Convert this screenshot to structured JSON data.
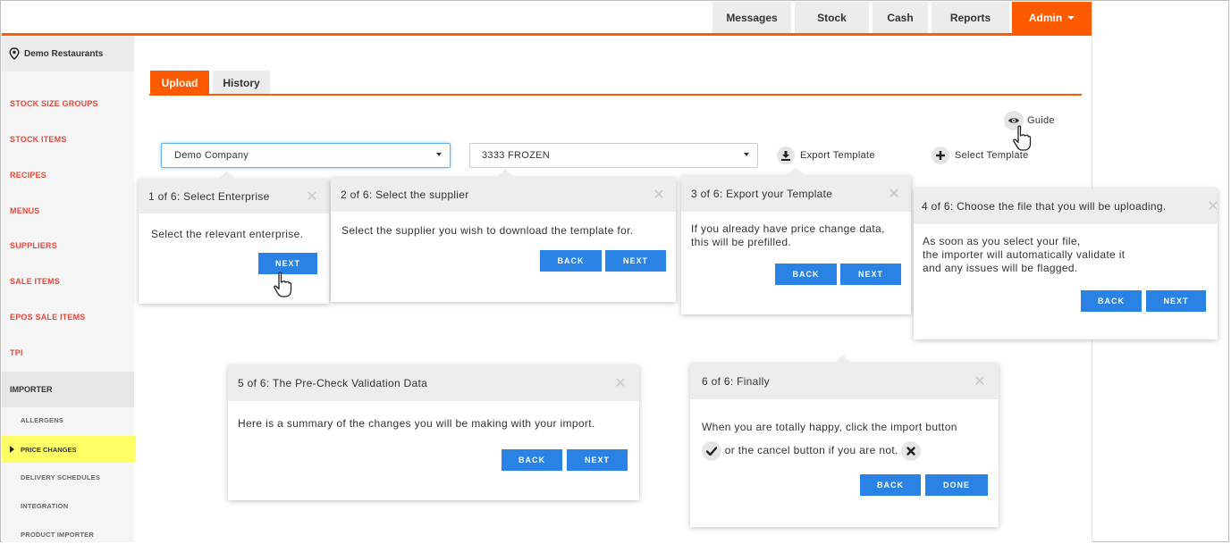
{
  "nav": {
    "items": [
      "Messages",
      "Stock",
      "Cash",
      "Reports"
    ],
    "admin_label": "Admin",
    "accent_color": "#ff5a00"
  },
  "sidebar": {
    "location": "Demo Restaurants",
    "items": [
      "STOCK SIZE GROUPS",
      "STOCK ITEMS",
      "RECIPES",
      "MENUS",
      "SUPPLIERS",
      "SALE ITEMS",
      "EPOS SALE ITEMS",
      "TPI"
    ],
    "section": "IMPORTER",
    "subitems": [
      "ALLERGENS",
      "PRICE CHANGES",
      "DELIVERY SCHEDULES",
      "INTEGRATION",
      "PRODUCT IMPORTER"
    ],
    "active_subitem": "PRICE CHANGES"
  },
  "tabs": {
    "upload": "Upload",
    "history": "History"
  },
  "form": {
    "enterprise_value": "Demo Company",
    "supplier_value": "3333 FROZEN",
    "export_template": "Export Template",
    "select_template": "Select Template",
    "guide": "Guide"
  },
  "steps": [
    {
      "title": "1 of 6: Select Enterprise",
      "body": "Select the relevant enterprise.",
      "next": "NEXT"
    },
    {
      "title": "2 of 6: Select the supplier",
      "body": "Select the supplier you wish to download the template for.",
      "back": "BACK",
      "next": "NEXT"
    },
    {
      "title": "3 of 6: Export your Template",
      "body_line1": "If you already have price change data,",
      "body_line2": "this will be prefilled.",
      "back": "BACK",
      "next": "NEXT"
    },
    {
      "title": "4 of 6: Choose the file that you will be uploading.",
      "body_line1": "As soon as you select your file,",
      "body_line2": "the importer will automatically validate it",
      "body_line3": "and any issues will be flagged.",
      "back": "BACK",
      "next": "NEXT"
    },
    {
      "title": "5 of 6: The Pre-Check Validation Data",
      "body": "Here is a summary of the changes you will be making with your import.",
      "back": "BACK",
      "next": "NEXT"
    },
    {
      "title": "6 of 6: Finally",
      "body_line1": "When you are totally happy, click the import button",
      "body_line2": "or the cancel button if you are not.",
      "back": "BACK",
      "done": "DONE"
    }
  ],
  "colors": {
    "button": "#2a82e4",
    "sidebar_link": "#e8483b",
    "highlight": "#ffff66"
  }
}
